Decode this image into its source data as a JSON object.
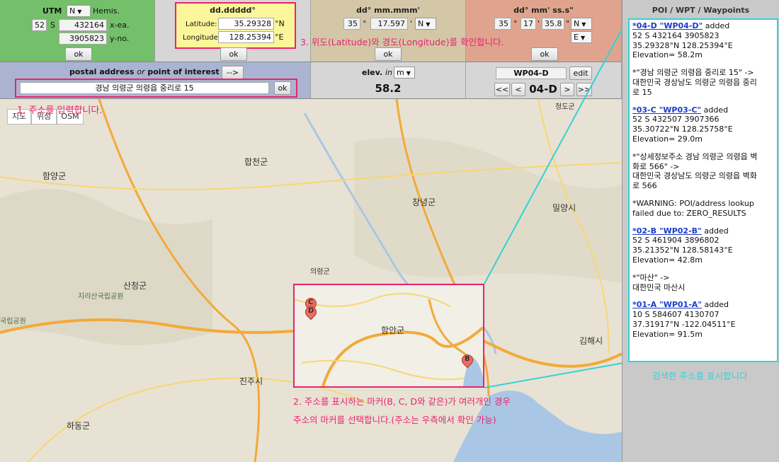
{
  "utm": {
    "title": "UTM",
    "hemis_value": "N",
    "hemis_label": "Hemis.",
    "zone": "52",
    "band": "S",
    "easting": "432164",
    "easting_label": "x-ea.",
    "northing": "3905823",
    "northing_label": "y-no.",
    "ok_label": "ok"
  },
  "decimal": {
    "title": "dd.ddddd°",
    "lat_label": "Latitude:",
    "lat_value": "35.29328",
    "lat_unit": "°N",
    "lon_label": "Longitude:",
    "lon_value": "128.25394",
    "lon_unit": "°E",
    "ok_label": "ok"
  },
  "ddm": {
    "title": "dd° mm.mmm'",
    "deg": "35",
    "deg_sym": "°",
    "min": "17.597",
    "min_sym": "'",
    "hemi": "N",
    "ok_label": "ok"
  },
  "dms": {
    "title": "dd° mm' ss.s\"",
    "deg": "35",
    "deg_sym": "°",
    "min": "17",
    "min_sym": "'",
    "sec": "35.8",
    "sec_sym": "\"",
    "hemi_lat": "N",
    "hemi_lon": "E",
    "ok_label": "ok"
  },
  "address": {
    "title_part1": "postal address",
    "title_or": "or",
    "title_part2": "point of interest (poi)",
    "arrow_button": "-->",
    "input_value": "경남 의령군 의령읍 중리로 15",
    "ok_label": "ok"
  },
  "elevation": {
    "title": "elev.",
    "title_in": "in",
    "unit": "m",
    "value": "58.2"
  },
  "waypoint": {
    "name": "WP04-D",
    "edit_label": "edit",
    "current": "04-D",
    "first_label": "<<",
    "prev_label": "<",
    "next_label": ">",
    "last_label": ">>"
  },
  "map": {
    "type_buttons": [
      "지도",
      "위성",
      "OSM"
    ],
    "places": [
      "합천군",
      "함양군",
      "창녕군",
      "밀양시",
      "의령군",
      "산청군",
      "지리산국립공원",
      "국립공원",
      "함안군",
      "김해시",
      "진주시",
      "하동군",
      "청도군"
    ],
    "markers": [
      "C",
      "D",
      "B"
    ]
  },
  "annotations": {
    "step1": "1. 주소를 입력합니다.",
    "step2_line1": "2. 주소를 표시하는 마커(B, C, D와 같은)가 여러개인 경우",
    "step2_line2": "주소의 마커를 선택합니다.(주소는 우측에서 확인 가능)",
    "step3": "3. 위도(Latitude)와 경도(Longitude)를 확인합니다.",
    "step4": "검색한 주소를 표시합니다"
  },
  "sidebar": {
    "title": "POI / WPT / Waypoints",
    "log": [
      {
        "type": "wp",
        "link": "*04-D \"WP04-D\"",
        "suffix": " added",
        "lines": [
          "52 S 432164 3905823",
          "35.29328°N 128.25394°E",
          "Elevation= 58.2m"
        ]
      },
      {
        "type": "text",
        "lines": [
          "*\"경남 의령군 의령읍 중리로 15\" ->",
          "대한민국 경상남도 의령군 의령읍 중리",
          "로 15"
        ]
      },
      {
        "type": "wp",
        "link": "*03-C \"WP03-C\"",
        "suffix": " added",
        "lines": [
          "52 S 432507 3907366",
          "35.30722°N 128.25758°E",
          "Elevation= 29.0m"
        ]
      },
      {
        "type": "text",
        "lines": [
          "*\"상세정보주소 경남 의령군 의령읍 벽",
          "화로 566\" ->",
          "대한민국 경상남도 의령군 의령읍 벽화",
          "로 566"
        ]
      },
      {
        "type": "text",
        "lines": [
          "*WARNING: POI/address lookup",
          "failed due to: ZERO_RESULTS"
        ]
      },
      {
        "type": "wp",
        "link": "*02-B \"WP02-B\"",
        "suffix": " added",
        "lines": [
          "52 S 461904 3896802",
          "35.21352°N 128.58143°E",
          "Elevation= 42.8m"
        ]
      },
      {
        "type": "text",
        "lines": [
          "*\"마산\" ->",
          "대한민국 마산시"
        ]
      },
      {
        "type": "wp",
        "link": "*01-A \"WP01-A\"",
        "suffix": " added",
        "lines": [
          "10 S 584607 4130707",
          "37.31917°N -122.04511°E",
          "Elevation= 91.5m"
        ]
      }
    ]
  },
  "colors": {
    "utm_bg": "#74bf6a",
    "decimal_bg": "#fbf69a",
    "ddm_bg": "#d3c7a8",
    "dms_bg": "#e0a48e",
    "address_bg": "#aab4d2",
    "elev_bg": "#d6d6d6",
    "annotation": "#e8246e",
    "callout": "#34d2d6"
  }
}
